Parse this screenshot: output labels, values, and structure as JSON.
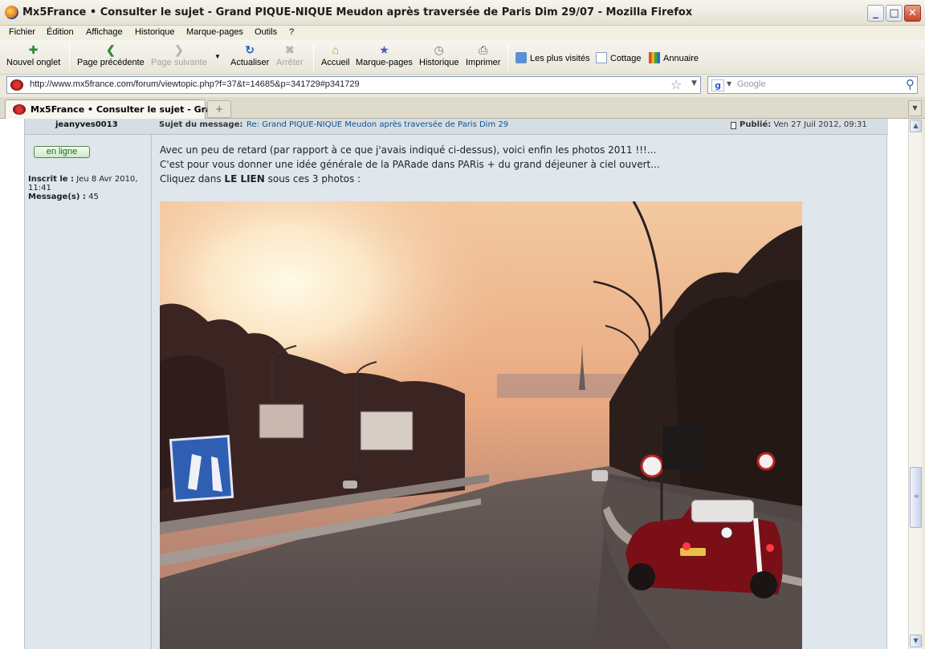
{
  "window": {
    "title": "Mx5France • Consulter le sujet - Grand PIQUE-NIQUE Meudon après traversée de Paris Dim 29/07 - Mozilla Firefox",
    "minimize": "_",
    "maximize": "□",
    "close": "✕"
  },
  "menu": [
    "Fichier",
    "Édition",
    "Affichage",
    "Historique",
    "Marque-pages",
    "Outils",
    "?"
  ],
  "toolbar": {
    "new_tab": "Nouvel onglet",
    "back": "Page précédente",
    "forward": "Page suivante",
    "reload": "Actualiser",
    "stop": "Arrêter",
    "home": "Accueil",
    "bookmarks": "Marque-pages",
    "history": "Historique",
    "print": "Imprimer"
  },
  "bookmarks_bar": [
    "Les plus visités",
    "Cottage",
    "Annuaire"
  ],
  "address": {
    "url": "http://www.mx5france.com/forum/viewtopic.php?f=37&t=14685&p=341729#p341729"
  },
  "search": {
    "placeholder": "Google",
    "engine_glyph": "g"
  },
  "tabs": [
    {
      "title": "Mx5France • Consulter le sujet - Gra..."
    }
  ],
  "new_tab_glyph": "+",
  "post": {
    "author": "jeanyves0013",
    "subject_label": "Sujet du message:",
    "subject": "Re: Grand PIQUE-NIQUE Meudon après traversée de Paris Dim 29",
    "published_label": "Publié:",
    "published_date": "Ven 27 Juil 2012, 09:31",
    "online_badge": "en ligne",
    "joined_label": "Inscrit le :",
    "joined_value": "Jeu 8 Avr 2010,",
    "joined_time": "11:41",
    "messages_label": "Message(s) :",
    "messages_value": "45",
    "body_line1": "Avec un peu de retard (par rapport à ce que j'avais indiqué ci-dessus), voici enfin les photos 2011 !!!...",
    "body_line2": "C'est pour vous donner une idée générale de la PARade dans PARis + du grand déjeuner à ciel ouvert...",
    "body_line3_a": "Cliquez dans ",
    "body_line3_b": "LE LIEN",
    "body_line3_c": " sous ces 3 photos :"
  },
  "photo": {
    "motorway_sign_color": "#2f5fb3",
    "car_color": "#7a0f18"
  }
}
